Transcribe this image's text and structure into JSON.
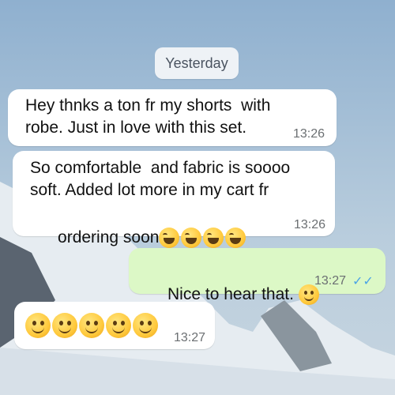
{
  "chat": {
    "date_label": "Yesterday",
    "messages": [
      {
        "direction": "incoming",
        "lines": [
          "Hey thnks a ton fr my shorts  with",
          "robe. Just in love with this set."
        ],
        "time": "13:26"
      },
      {
        "direction": "incoming",
        "lines": [
          "So comfortable  and fabric is soooo",
          "soft. Added lot more in my cart fr",
          "ordering soon"
        ],
        "emoji": [
          "laughing-tears-emoji",
          "laughing-tears-emoji",
          "laughing-tears-emoji",
          "laughing-tears-emoji"
        ],
        "time": "13:26"
      },
      {
        "direction": "outgoing",
        "lines": [
          "Nice to hear that. "
        ],
        "emoji": [
          "smiling-face-emoji"
        ],
        "time": "13:27",
        "status": "read"
      },
      {
        "direction": "incoming",
        "emoji": [
          "smiling-face-emoji",
          "smiling-face-emoji",
          "smiling-face-emoji",
          "smiling-face-emoji",
          "smiling-face-emoji"
        ],
        "time": "13:27"
      }
    ]
  },
  "colors": {
    "incoming_bubble": "#ffffff",
    "outgoing_bubble": "#dcf8c6",
    "read_ticks": "#4aa3e6",
    "sky": "#94b3cf"
  }
}
